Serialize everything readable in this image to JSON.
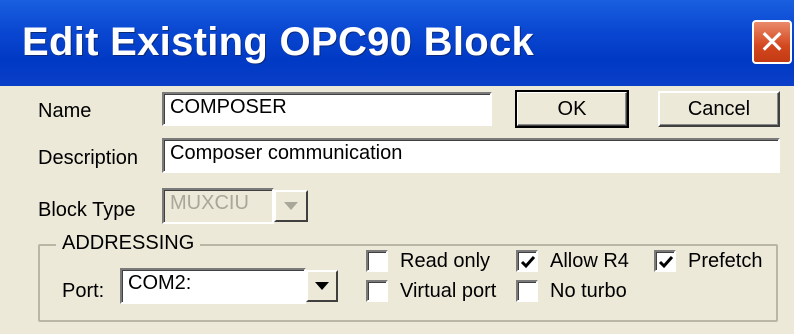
{
  "window": {
    "title": "Edit Existing OPC90 Block",
    "close_glyph": "✕"
  },
  "form": {
    "name_label": "Name",
    "name_value": "COMPOSER",
    "description_label": "Description",
    "description_value": "Composer communication",
    "block_type_label": "Block Type",
    "block_type_value": "MUXCIU",
    "block_type_enabled": false
  },
  "buttons": {
    "ok": "OK",
    "cancel": "Cancel"
  },
  "addressing": {
    "legend": "ADDRESSING",
    "port_label": "Port:",
    "port_value": "COM2:",
    "options": {
      "read_only": {
        "label": "Read only",
        "checked": false
      },
      "virtual_port": {
        "label": "Virtual port",
        "checked": false
      },
      "allow_r4": {
        "label": "Allow R4",
        "checked": true
      },
      "no_turbo": {
        "label": "No turbo",
        "checked": false
      },
      "prefetch": {
        "label": "Prefetch",
        "checked": true
      }
    }
  },
  "colors": {
    "titlebar": "#0a48d2",
    "dialog_bg": "#ece9d8",
    "close_button": "#d4471e"
  },
  "icons": {
    "close": "close-icon",
    "dropdown": "dropdown-arrow-icon",
    "check": "checkmark-icon"
  }
}
